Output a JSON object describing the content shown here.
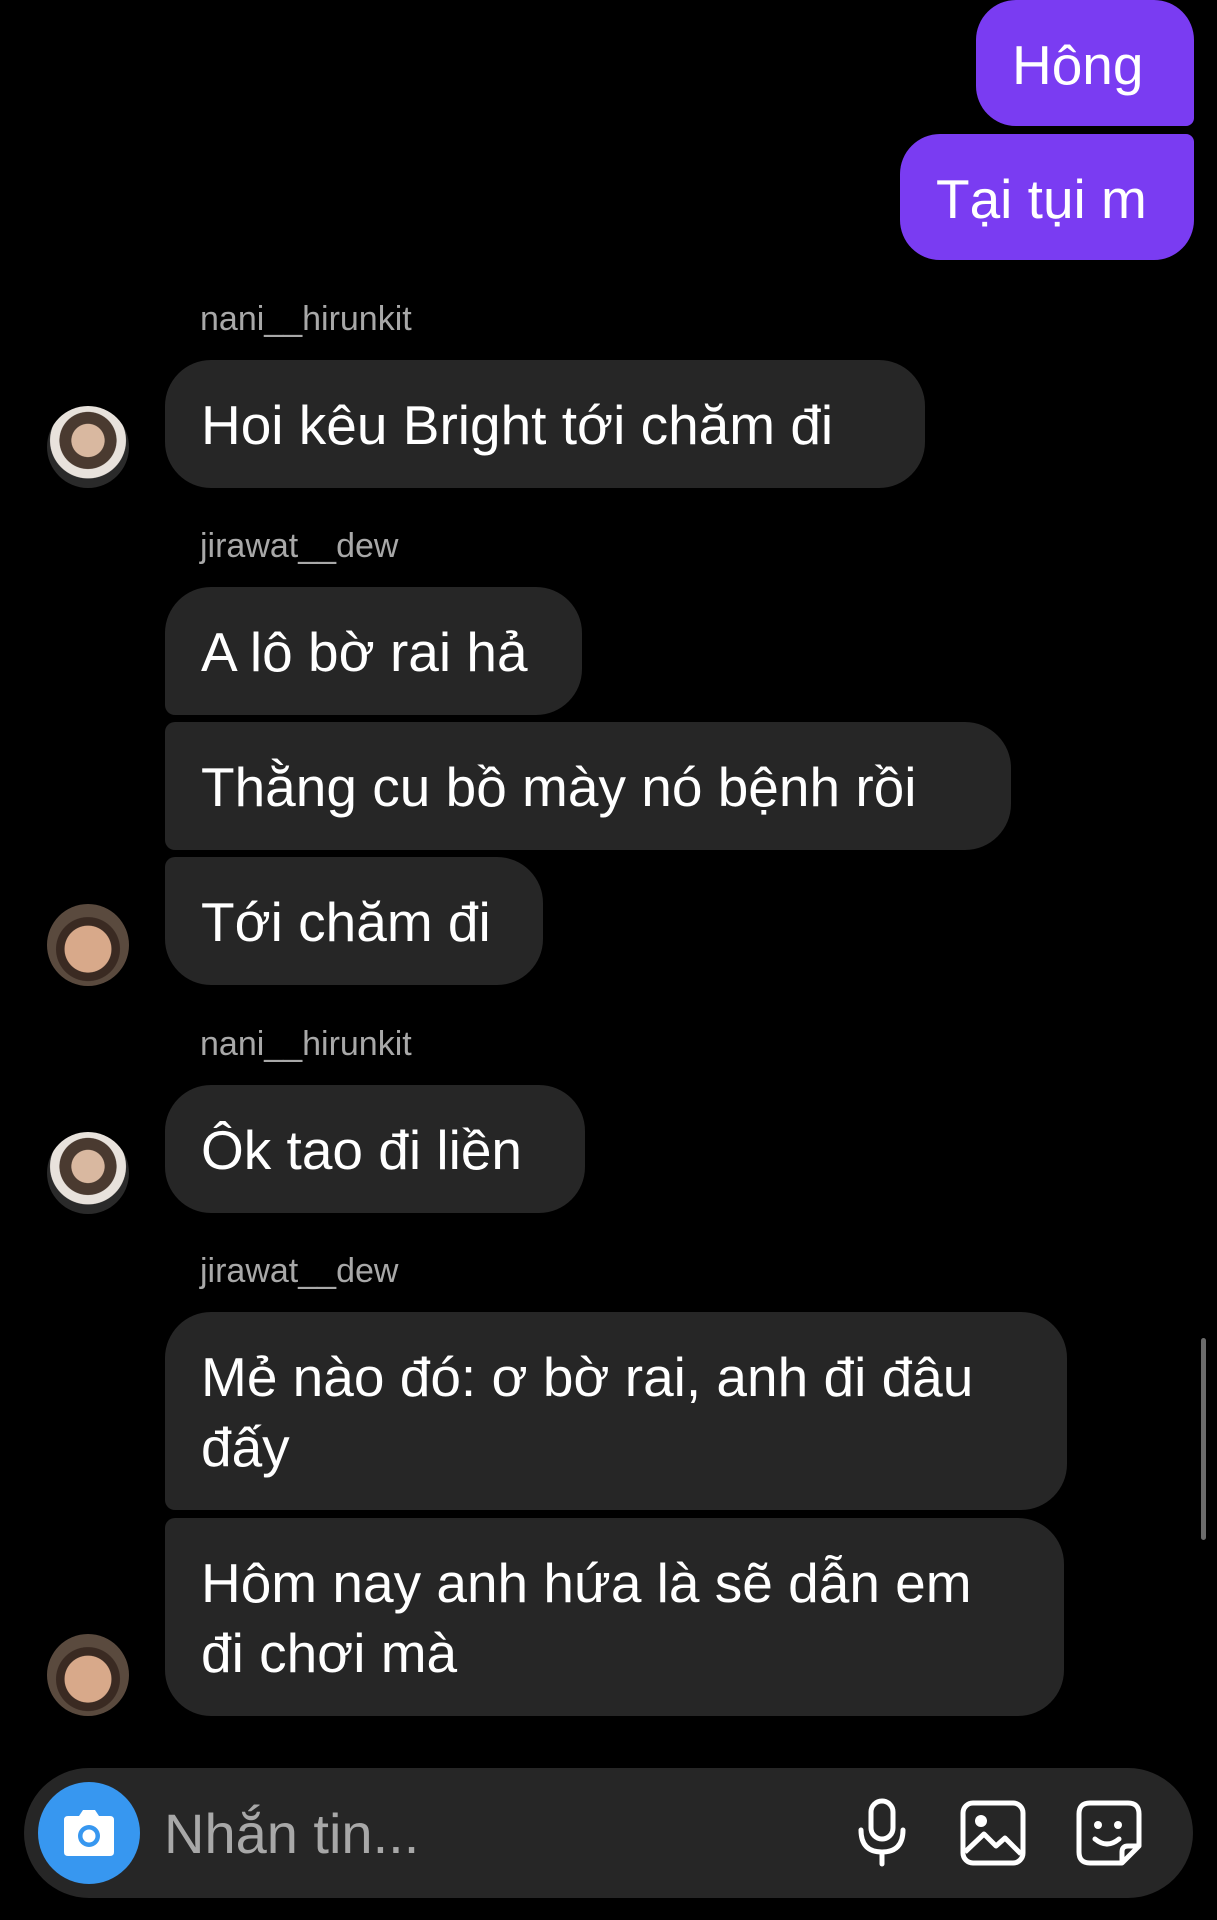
{
  "messages": {
    "out_1": "Hông",
    "out_2": "Tại tụi m",
    "sender_1": "nani__hirunkit",
    "in_1": "Hoi kêu Bright tới chăm đi",
    "sender_2": "jirawat__dew",
    "in_2": "A lô bờ rai hả",
    "in_3": "Thằng cu bồ mày nó bệnh rồi",
    "in_4": "Tới chăm đi",
    "sender_3": "nani__hirunkit",
    "in_5": "Ôk tao đi liền",
    "sender_4": "jirawat__dew",
    "in_6": "Mẻ nào đó: ơ bờ rai, anh đi đâu đấy",
    "in_7": "Hôm nay anh hứa là sẽ dẫn em đi chơi mà"
  },
  "composer": {
    "placeholder": "Nhắn tin...",
    "camera_icon": "camera-icon",
    "mic_icon": "microphone-icon",
    "gallery_icon": "image-gallery-icon",
    "sticker_icon": "sticker-icon"
  },
  "colors": {
    "background": "#000000",
    "incoming_bubble": "#262626",
    "outgoing_bubble": "#7a3cf2",
    "sender_name": "#a8a8a8",
    "camera_button": "#3797f0",
    "composer": "#262626"
  }
}
